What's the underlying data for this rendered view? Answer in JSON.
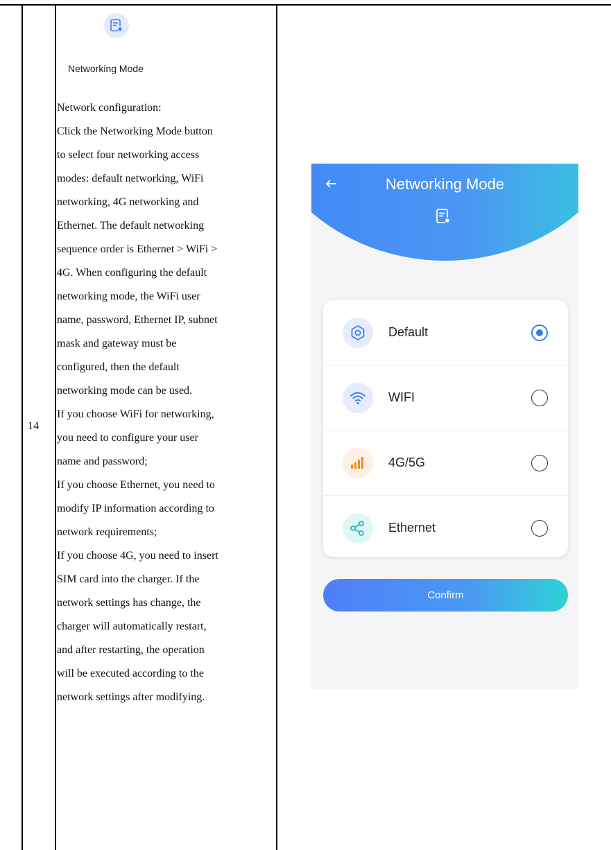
{
  "table": {
    "row_number": "14",
    "feature_label": "Networking Mode",
    "description_lines": [
      "Network configuration:",
      "Click the Networking Mode button",
      "to select four networking access",
      "modes: default networking, WiFi",
      "networking, 4G networking and",
      "Ethernet. The default networking",
      "sequence order is Ethernet > WiFi >",
      "4G. When configuring the default",
      "networking mode, the WiFi user",
      "name, password, Ethernet IP, subnet",
      "mask and gateway must be",
      "configured, then the default",
      "networking mode can be used.",
      "If you choose WiFi for networking,",
      "you need to configure your user",
      "name and password;",
      "If you choose Ethernet, you need to",
      "modify IP information according to",
      "network requirements;",
      "If you choose 4G, you need to insert",
      "SIM card into the charger. If the",
      "network settings has change, the",
      "charger will automatically restart,",
      "and after restarting, the operation",
      "will be executed according to the",
      "network settings after modifying."
    ]
  },
  "screen": {
    "title": "Networking Mode",
    "options": [
      {
        "label": "Default",
        "icon": "gear-icon",
        "selected": true
      },
      {
        "label": "WIFI",
        "icon": "wifi-icon",
        "selected": false
      },
      {
        "label": "4G/5G",
        "icon": "signal-bars-icon",
        "selected": false
      },
      {
        "label": "Ethernet",
        "icon": "network-nodes-icon",
        "selected": false
      }
    ],
    "confirm_label": "Confirm"
  },
  "colors": {
    "accent_blue": "#3a7df1",
    "gradient_start": "#3f85f7",
    "gradient_end": "#2fd6d6",
    "signal_orange": "#f28a1c"
  }
}
